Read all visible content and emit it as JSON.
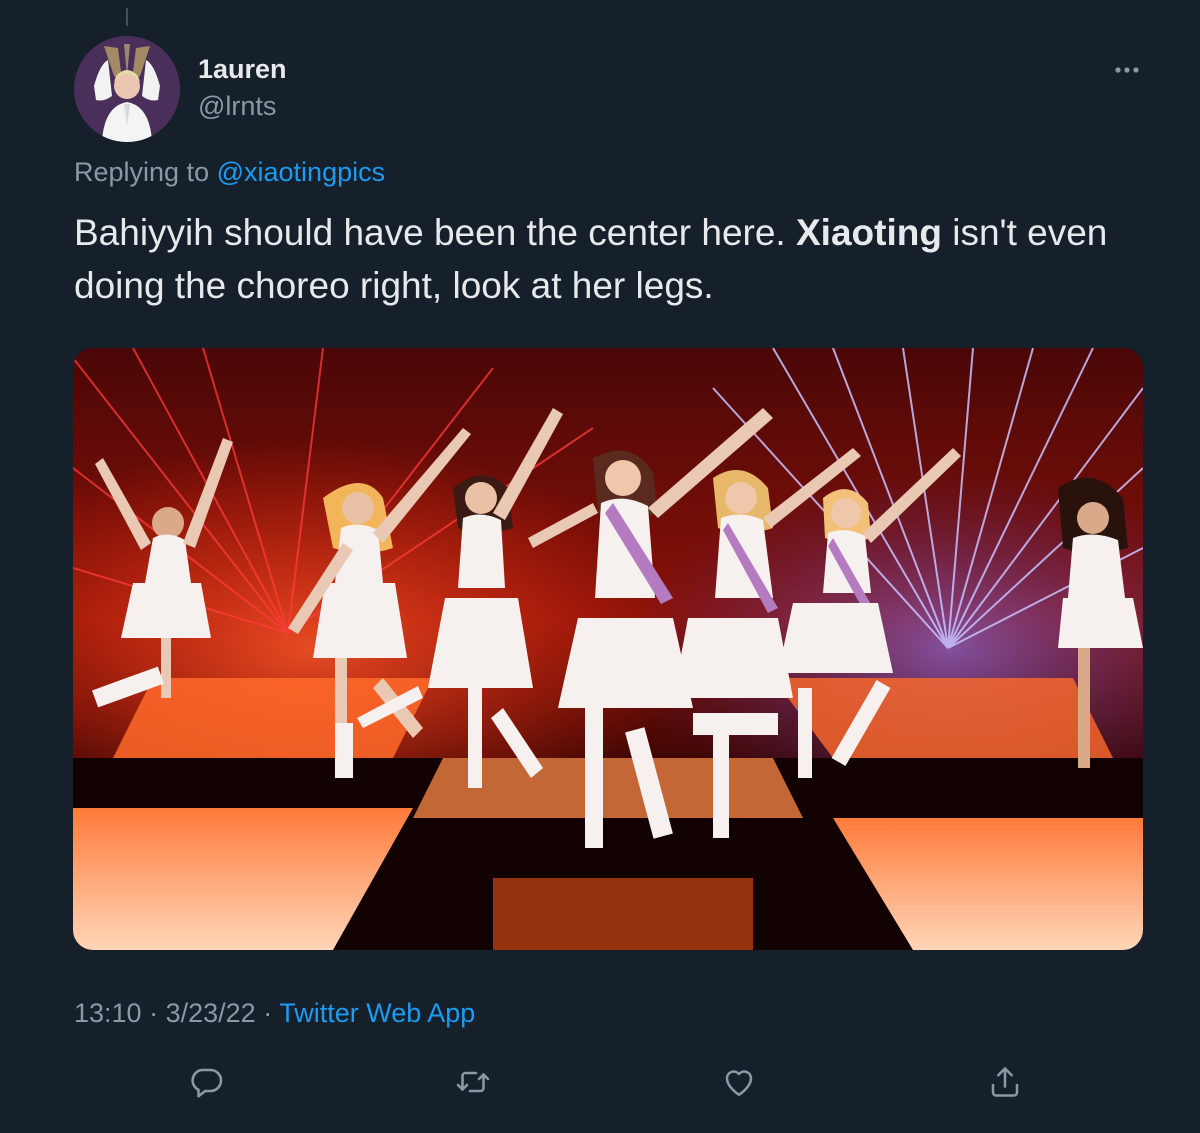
{
  "tweet": {
    "author": {
      "display_name": "1auren",
      "handle": "@lrnts"
    },
    "reply": {
      "prefix": "Replying to",
      "mention": "@xiaotingpics"
    },
    "text": {
      "part1": "Bahiyyih should have been the center here.",
      "bold": "Xiaoting",
      "part2": "isn't even doing the choreo right, look at her legs."
    },
    "meta": {
      "time": "13:10",
      "separator1": "·",
      "date": "3/23/22",
      "separator2": "·",
      "source": "Twitter Web App"
    },
    "actions": {
      "reply_icon": "reply-icon",
      "retweet_icon": "retweet-icon",
      "like_icon": "heart-icon",
      "share_icon": "share-icon"
    }
  },
  "colors": {
    "background": "#15202b",
    "text_primary": "#e7e9ea",
    "text_secondary": "#8b98a5",
    "link": "#1d9bf0"
  }
}
